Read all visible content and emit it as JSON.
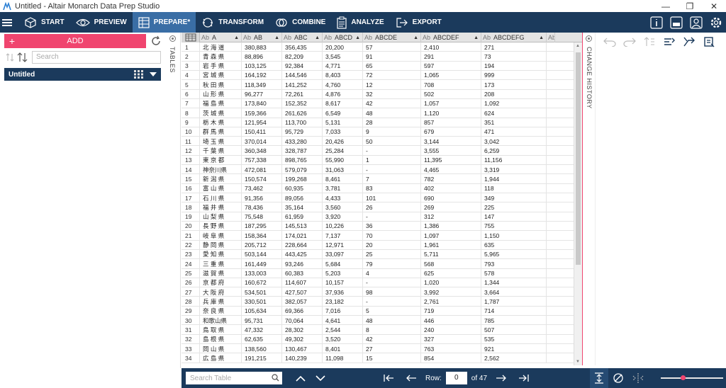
{
  "window": {
    "title": "Untitled - Altair Monarch Data Prep Studio",
    "min": "—",
    "restore": "❐",
    "close": "✕"
  },
  "toolbar": {
    "items": [
      {
        "label": "START",
        "icon": "cube-icon"
      },
      {
        "label": "PREVIEW",
        "icon": "eye-icon"
      },
      {
        "label": "PREPARE*",
        "icon": "table-icon",
        "active": true
      },
      {
        "label": "TRANSFORM",
        "icon": "transform-icon"
      },
      {
        "label": "COMBINE",
        "icon": "combine-icon"
      },
      {
        "label": "ANALYZE",
        "icon": "clipboard-icon"
      },
      {
        "label": "EXPORT",
        "icon": "export-icon"
      }
    ]
  },
  "left": {
    "add_label": "ADD",
    "search_placeholder": "Search",
    "dataset_name": "Untitled"
  },
  "tables_tab": "TABLES",
  "change_history_tab": "CHANGE HISTORY",
  "grid": {
    "columns": [
      {
        "type": "Ab",
        "name": "A"
      },
      {
        "type": "Ab",
        "name": "AB"
      },
      {
        "type": "Ab",
        "name": "ABC"
      },
      {
        "type": "Ab",
        "name": "ABCD"
      },
      {
        "type": "Ab",
        "name": "ABCDE"
      },
      {
        "type": "Ab",
        "name": "ABCDEF"
      },
      {
        "type": "Ab",
        "name": "ABCDEFG"
      },
      {
        "type": "Ab",
        "name": ""
      }
    ],
    "rows": [
      [
        "1",
        "北 海 道",
        "380,883",
        "356,435",
        "20,200",
        "57",
        "2,410",
        "271"
      ],
      [
        "2",
        "青 森 県",
        "88,896",
        "82,209",
        "3,545",
        "91",
        "291",
        "73"
      ],
      [
        "3",
        "岩 手 県",
        "103,125",
        "92,384",
        "4,771",
        "65",
        "597",
        "194"
      ],
      [
        "4",
        "宮 城 県",
        "164,192",
        "144,546",
        "8,403",
        "72",
        "1,065",
        "999"
      ],
      [
        "5",
        "秋 田 県",
        "118,349",
        "141,252",
        "4,760",
        "12",
        "708",
        "173"
      ],
      [
        "6",
        "山 形 県",
        "96,277",
        "72,261",
        "4,876",
        "32",
        "502",
        "208"
      ],
      [
        "7",
        "福 島 県",
        "173,840",
        "152,352",
        "8,617",
        "42",
        "1,057",
        "1,092"
      ],
      [
        "8",
        "茨 城 県",
        "159,366",
        "261,626",
        "6,549",
        "48",
        "1,120",
        "624"
      ],
      [
        "9",
        "栃 木 県",
        "121,954",
        "113,700",
        "5,131",
        "28",
        "857",
        "351"
      ],
      [
        "10",
        "群 馬 県",
        "150,411",
        "95,729",
        "7,033",
        "9",
        "679",
        "471"
      ],
      [
        "11",
        "埼 玉 県",
        "370,014",
        "433,280",
        "20,426",
        "50",
        "3,144",
        "3,042"
      ],
      [
        "12",
        "千 葉 県",
        "360,348",
        "328,787",
        "25,284",
        "-",
        "3,555",
        "6,259"
      ],
      [
        "13",
        "東 京 都",
        "757,338",
        "898,765",
        "55,990",
        "1",
        "11,395",
        "11,156"
      ],
      [
        "14",
        "神奈川県",
        "472,081",
        "579,079",
        "31,063",
        "-",
        "4,465",
        "3,319"
      ],
      [
        "15",
        "新 潟 県",
        "150,574",
        "199,268",
        "8,461",
        "7",
        "782",
        "1,944"
      ],
      [
        "16",
        "富 山 県",
        "73,462",
        "60,935",
        "3,781",
        "83",
        "402",
        "118"
      ],
      [
        "17",
        "石 川 県",
        "91,356",
        "89,056",
        "4,433",
        "101",
        "690",
        "349"
      ],
      [
        "18",
        "福 井 県",
        "78,436",
        "35,164",
        "3,560",
        "26",
        "269",
        "225"
      ],
      [
        "19",
        "山 梨 県",
        "75,548",
        "61,959",
        "3,920",
        "-",
        "312",
        "147"
      ],
      [
        "20",
        "長 野 県",
        "187,295",
        "145,513",
        "10,226",
        "36",
        "1,386",
        "755"
      ],
      [
        "21",
        "岐 阜 県",
        "158,364",
        "174,021",
        "7,137",
        "70",
        "1,097",
        "1,150"
      ],
      [
        "22",
        "静 岡 県",
        "205,712",
        "228,664",
        "12,971",
        "20",
        "1,961",
        "635"
      ],
      [
        "23",
        "愛 知 県",
        "503,144",
        "443,425",
        "33,097",
        "25",
        "5,711",
        "5,965"
      ],
      [
        "24",
        "三 重 県",
        "161,449",
        "93,246",
        "5,684",
        "79",
        "568",
        "793"
      ],
      [
        "25",
        "滋 賀 県",
        "133,003",
        "60,383",
        "5,203",
        "4",
        "625",
        "578"
      ],
      [
        "26",
        "京 都 府",
        "160,672",
        "114,607",
        "10,157",
        "-",
        "1,020",
        "1,344"
      ],
      [
        "27",
        "大 阪 府",
        "534,501",
        "427,507",
        "37,936",
        "98",
        "3,992",
        "3,664"
      ],
      [
        "28",
        "兵 庫 県",
        "330,501",
        "382,057",
        "23,182",
        "-",
        "2,761",
        "1,787"
      ],
      [
        "29",
        "奈 良 県",
        "105,634",
        "69,366",
        "7,016",
        "5",
        "719",
        "714"
      ],
      [
        "30",
        "和歌山県",
        "95,731",
        "70,064",
        "4,641",
        "48",
        "446",
        "785"
      ],
      [
        "31",
        "鳥 取 県",
        "47,332",
        "28,302",
        "2,544",
        "8",
        "240",
        "507"
      ],
      [
        "32",
        "島 根 県",
        "62,635",
        "49,302",
        "3,520",
        "42",
        "327",
        "535"
      ],
      [
        "33",
        "岡 山 県",
        "138,560",
        "130,467",
        "8,401",
        "27",
        "763",
        "921"
      ],
      [
        "34",
        "広 島 県",
        "191,215",
        "140,239",
        "11,098",
        "15",
        "854",
        "2,562"
      ]
    ]
  },
  "bottom": {
    "search_placeholder": "Search Table",
    "row_label": "Row:",
    "row_value": "0",
    "of_label": "of 47"
  }
}
